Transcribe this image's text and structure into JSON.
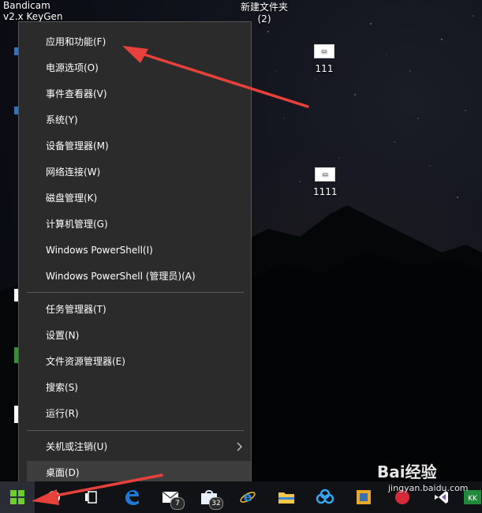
{
  "desktop": {
    "icons": [
      {
        "line1": "Bandicam",
        "line2": "v2.x KeyGen"
      },
      {
        "line1": "新建文件夹",
        "line2": "(2)"
      },
      {
        "label": "111"
      },
      {
        "label": "1111"
      }
    ]
  },
  "context_menu": {
    "group1": [
      "应用和功能(F)",
      "电源选项(O)",
      "事件查看器(V)",
      "系统(Y)",
      "设备管理器(M)",
      "网络连接(W)",
      "磁盘管理(K)",
      "计算机管理(G)",
      "Windows PowerShell(I)",
      "Windows PowerShell (管理员)(A)"
    ],
    "group2": [
      "任务管理器(T)",
      "设置(N)",
      "文件资源管理器(E)",
      "搜索(S)",
      "运行(R)"
    ],
    "group3": [
      "关机或注销(U)",
      "桌面(D)"
    ]
  },
  "taskbar": {
    "mail_badge": "7",
    "store_badge": "32",
    "last_app_label": "KK"
  },
  "watermark": {
    "logo": "Bai经验",
    "url": "jingyan.baidu.com"
  }
}
